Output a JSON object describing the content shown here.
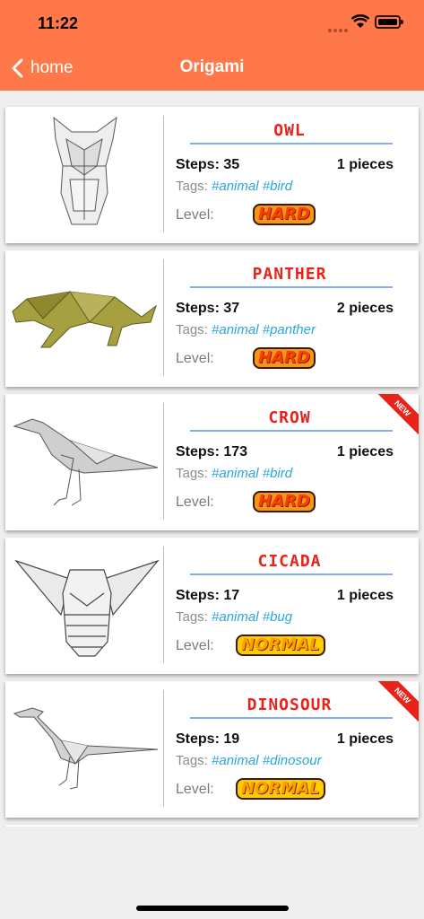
{
  "status": {
    "time": "11:22"
  },
  "nav": {
    "back_label": "home",
    "title": "Origami"
  },
  "labels": {
    "steps": "Steps:",
    "tags": "Tags:",
    "level": "Level:",
    "new": "NEW"
  },
  "items": [
    {
      "name": "OWL",
      "steps": "35",
      "pieces": "1 pieces",
      "tags": "#animal #bird",
      "level": "HARD",
      "is_new": false,
      "icon": "owl-origami"
    },
    {
      "name": "PANTHER",
      "steps": "37",
      "pieces": "2 pieces",
      "tags": "#animal #panther",
      "level": "HARD",
      "is_new": false,
      "icon": "panther-origami"
    },
    {
      "name": "CROW",
      "steps": "173",
      "pieces": "1 pieces",
      "tags": "#animal #bird",
      "level": "HARD",
      "is_new": true,
      "icon": "crow-origami"
    },
    {
      "name": "CICADA",
      "steps": "17",
      "pieces": "1 pieces",
      "tags": "#animal #bug",
      "level": "NORMAL",
      "is_new": false,
      "icon": "cicada-origami"
    },
    {
      "name": "DINOSOUR",
      "steps": "19",
      "pieces": "1 pieces",
      "tags": "#animal #dinosour",
      "level": "NORMAL",
      "is_new": true,
      "icon": "dinosaur-origami"
    }
  ],
  "colors": {
    "header": "#ff7849",
    "name": "#e8231a",
    "tag": "#2aa6dd"
  }
}
